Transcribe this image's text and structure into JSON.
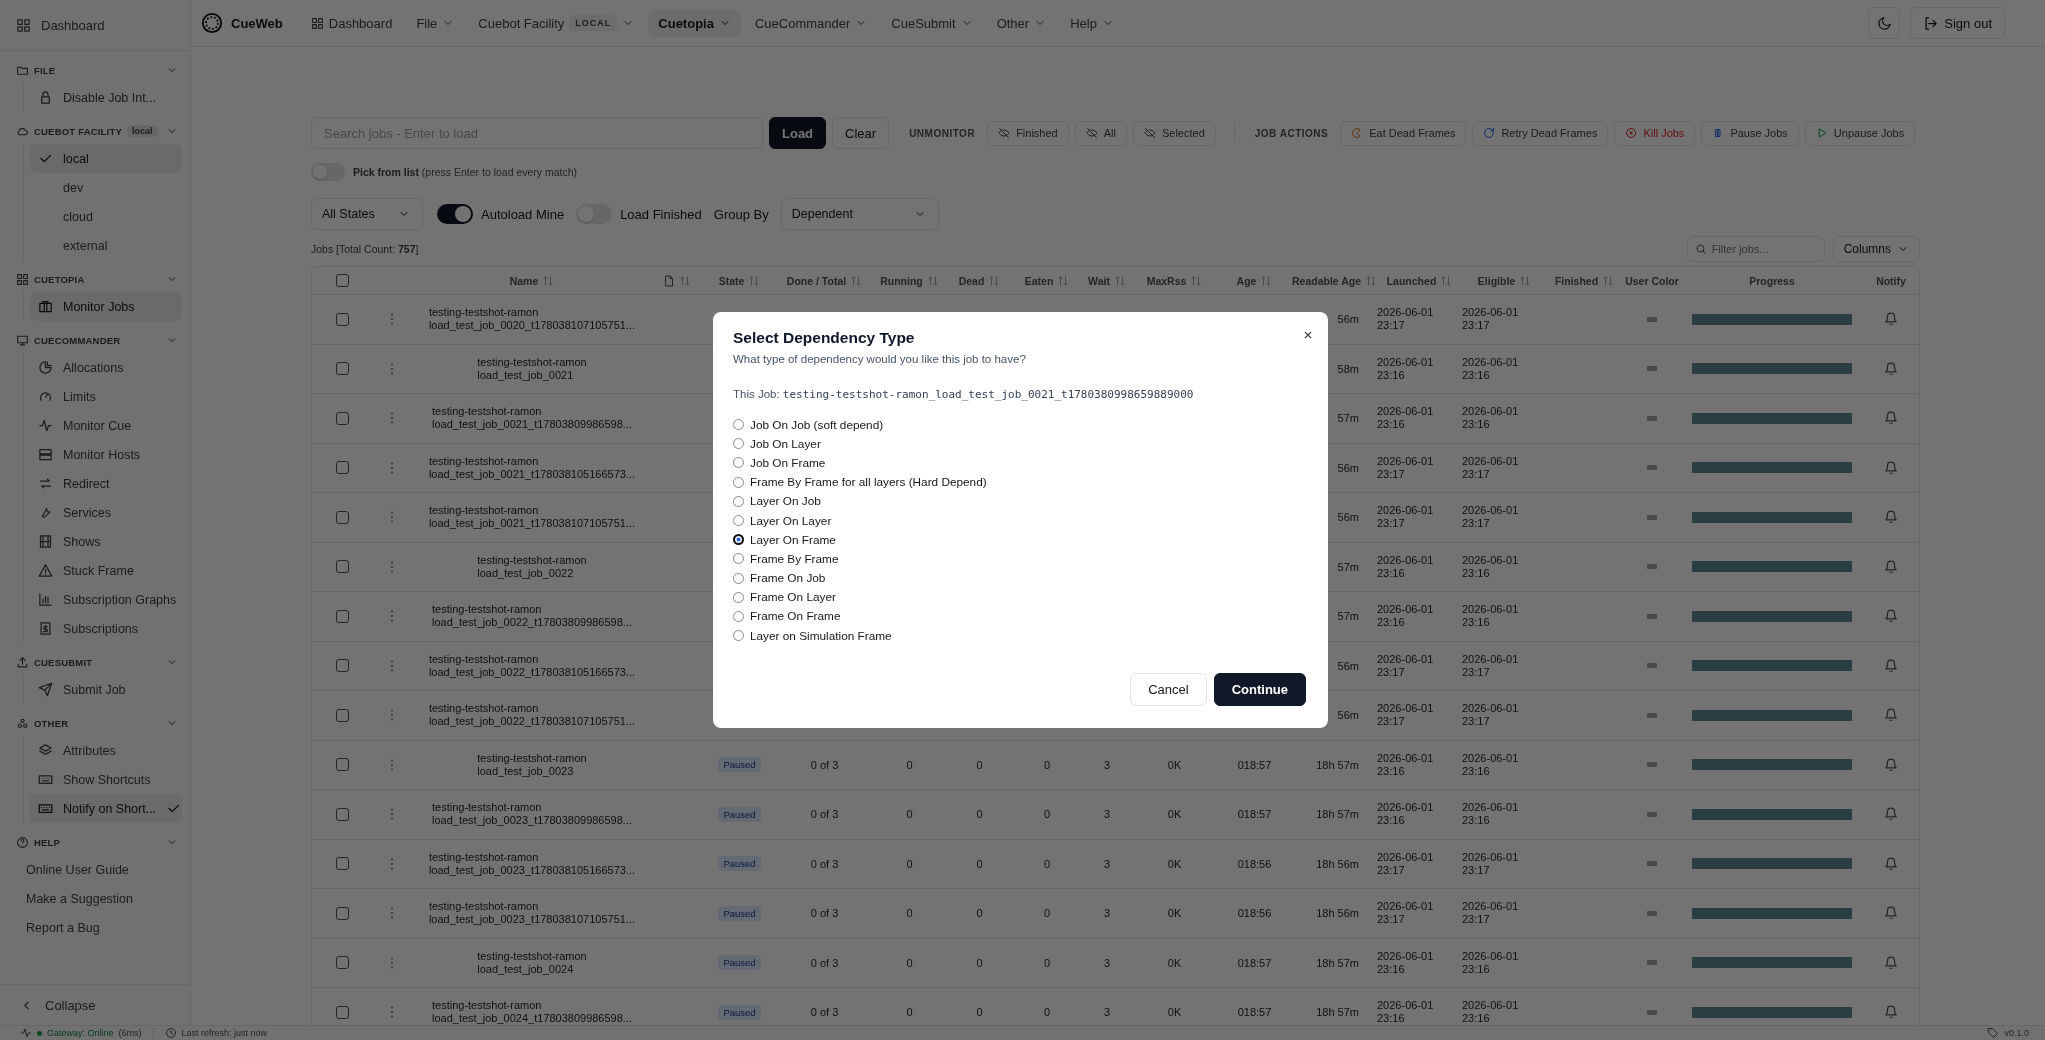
{
  "topbar": {
    "brand": "CueWeb",
    "nav": [
      {
        "label": "Dashboard",
        "kind": "link",
        "selected": false
      },
      {
        "label": "File",
        "kind": "menu",
        "selected": false
      },
      {
        "label": "Cuebot Facility",
        "kind": "menu",
        "badge": "LOCAL",
        "selected": false
      },
      {
        "label": "Cuetopia",
        "kind": "menu",
        "selected": true
      },
      {
        "label": "CueCommander",
        "kind": "menu",
        "selected": false
      },
      {
        "label": "CueSubmit",
        "kind": "menu",
        "selected": false
      },
      {
        "label": "Other",
        "kind": "menu",
        "selected": false
      },
      {
        "label": "Help",
        "kind": "menu",
        "selected": false
      }
    ],
    "sign_out": "Sign out"
  },
  "sidebar": {
    "dashboard": "Dashboard",
    "sections": [
      {
        "title": "FILE",
        "kind": "icons",
        "expanded": true,
        "items": [
          {
            "label": "Disable Job Int...",
            "selected": false,
            "checked": false
          }
        ]
      },
      {
        "title": "CUEBOT FACILITY",
        "badge": "local",
        "kind": "checks",
        "expanded": true,
        "items": [
          {
            "label": "local",
            "selected": true,
            "checked": true
          },
          {
            "label": "dev",
            "selected": false,
            "checked": false
          },
          {
            "label": "cloud",
            "selected": false,
            "checked": false
          },
          {
            "label": "external",
            "selected": false,
            "checked": false
          }
        ]
      },
      {
        "title": "CUETOPIA",
        "kind": "icons",
        "expanded": true,
        "items": [
          {
            "label": "Monitor Jobs",
            "selected": true,
            "checked": false
          }
        ]
      },
      {
        "title": "CUECOMMANDER",
        "kind": "icons",
        "expanded": true,
        "items": [
          {
            "label": "Allocations",
            "selected": false,
            "checked": false
          },
          {
            "label": "Limits",
            "selected": false,
            "checked": false
          },
          {
            "label": "Monitor Cue",
            "selected": false,
            "checked": false
          },
          {
            "label": "Monitor Hosts",
            "selected": false,
            "checked": false
          },
          {
            "label": "Redirect",
            "selected": false,
            "checked": false
          },
          {
            "label": "Services",
            "selected": false,
            "checked": false
          },
          {
            "label": "Shows",
            "selected": false,
            "checked": false
          },
          {
            "label": "Stuck Frame",
            "selected": false,
            "checked": false
          },
          {
            "label": "Subscription Graphs",
            "selected": false,
            "checked": false
          },
          {
            "label": "Subscriptions",
            "selected": false,
            "checked": false
          }
        ]
      },
      {
        "title": "CUESUBMIT",
        "kind": "icons",
        "expanded": true,
        "items": [
          {
            "label": "Submit Job",
            "selected": false,
            "checked": false
          }
        ]
      },
      {
        "title": "OTHER",
        "kind": "icons",
        "expanded": true,
        "items": [
          {
            "label": "Attributes",
            "selected": false,
            "checked": false
          },
          {
            "label": "Show Shortcuts",
            "selected": false,
            "checked": false
          },
          {
            "label": "Notify on Short...",
            "selected": true,
            "checked": true
          }
        ]
      },
      {
        "title": "HELP",
        "kind": "plain",
        "expanded": true,
        "items": [
          {
            "label": "Online User Guide",
            "selected": false,
            "checked": false
          },
          {
            "label": "Make a Suggestion",
            "selected": false,
            "checked": false
          },
          {
            "label": "Report a Bug",
            "selected": false,
            "checked": false
          }
        ]
      }
    ],
    "collapse": "Collapse"
  },
  "toolbar": {
    "search": {
      "placeholder": "Search jobs - Enter to load"
    },
    "load": "Load",
    "clear": "Clear",
    "unmonitor_label": "UNMONITOR",
    "unmonitor": [
      "Finished",
      "All",
      "Selected"
    ],
    "actions_label": "JOB ACTIONS",
    "actions": [
      {
        "label": "Eat Dead Frames",
        "kind": "normal"
      },
      {
        "label": "Retry Dead Frames",
        "kind": "normal"
      },
      {
        "label": "Kill Jobs",
        "kind": "danger"
      },
      {
        "label": "Pause Jobs",
        "kind": "normal"
      },
      {
        "label": "Unpause Jobs",
        "kind": "normal"
      }
    ]
  },
  "pick": {
    "on": false,
    "label": "Pick from list",
    "hint": "(press Enter to load every match)"
  },
  "filters": {
    "state": "All States",
    "autoload": {
      "label": "Autoload Mine",
      "on": true
    },
    "load_finished": {
      "label": "Load Finished",
      "on": false
    },
    "group_by_label": "Group By",
    "group_by": "Dependent"
  },
  "jobs_count": "Jobs [Total Count: **757**]",
  "filter_jobs": {
    "placeholder": "Filter jobs..."
  },
  "columns_button": "Columns",
  "table": {
    "all_checked": false,
    "columns": [
      {
        "kind": "text",
        "label": "Name",
        "sortable": true
      },
      {
        "kind": "file",
        "sortable": true
      },
      {
        "kind": "text",
        "label": "State",
        "sortable": true
      },
      {
        "kind": "text",
        "label": "Done / Total",
        "sortable": true
      },
      {
        "kind": "text",
        "label": "Running",
        "sortable": true
      },
      {
        "kind": "text",
        "label": "Dead",
        "sortable": true
      },
      {
        "kind": "text",
        "label": "Eaten",
        "sortable": true
      },
      {
        "kind": "text",
        "label": "Wait",
        "sortable": true
      },
      {
        "kind": "text",
        "label": "MaxRss",
        "sortable": true
      },
      {
        "kind": "text",
        "label": "Age",
        "sortable": true
      },
      {
        "kind": "text",
        "label": "Readable Age",
        "sortable": true
      },
      {
        "kind": "text",
        "label": "Launched",
        "sortable": true
      },
      {
        "kind": "text",
        "label": "Eligible",
        "sortable": true
      },
      {
        "kind": "text",
        "label": "Finished",
        "sortable": true
      },
      {
        "kind": "text",
        "label": "User Color",
        "sortable": false
      },
      {
        "kind": "text",
        "label": "Progress",
        "sortable": false
      },
      {
        "kind": "text",
        "label": "Notify",
        "sortable": false
      }
    ],
    "rows": [
      {
        "checked": false,
        "show": "testing-testshot-ramon",
        "job": "load_test_job_0020_t178038107105751...",
        "readable_age": "56m",
        "launched": [
          "2026-06-01",
          "23:17"
        ],
        "eligible": [
          "2026-06-01",
          "23:17"
        ],
        "level": 0
      },
      {
        "checked": false,
        "show": "testing-testshot-ramon",
        "job": "load_test_job_0021",
        "readable_age": "58m",
        "launched": [
          "2026-06-01",
          "23:16"
        ],
        "eligible": [
          "2026-06-01",
          "23:16"
        ],
        "level": 0
      },
      {
        "checked": false,
        "show": "testing-testshot-ramon",
        "job": "load_test_job_0021_t17803809986598...",
        "readable_age": "57m",
        "launched": [
          "2026-06-01",
          "23:16"
        ],
        "eligible": [
          "2026-06-01",
          "23:16"
        ],
        "level": 0
      },
      {
        "checked": false,
        "show": "testing-testshot-ramon",
        "job": "load_test_job_0021_t178038105166573...",
        "readable_age": "56m",
        "launched": [
          "2026-06-01",
          "23:17"
        ],
        "eligible": [
          "2026-06-01",
          "23:17"
        ],
        "level": 0
      },
      {
        "checked": false,
        "show": "testing-testshot-ramon",
        "job": "load_test_job_0021_t178038107105751...",
        "readable_age": "56m",
        "launched": [
          "2026-06-01",
          "23:17"
        ],
        "eligible": [
          "2026-06-01",
          "23:17"
        ],
        "level": 0
      },
      {
        "checked": false,
        "show": "testing-testshot-ramon",
        "job": "load_test_job_0022",
        "readable_age": "57m",
        "launched": [
          "2026-06-01",
          "23:16"
        ],
        "eligible": [
          "2026-06-01",
          "23:16"
        ],
        "level": 0
      },
      {
        "checked": false,
        "show": "testing-testshot-ramon",
        "job": "load_test_job_0022_t17803809986598...",
        "readable_age": "57m",
        "launched": [
          "2026-06-01",
          "23:16"
        ],
        "eligible": [
          "2026-06-01",
          "23:16"
        ],
        "level": 0
      },
      {
        "checked": false,
        "show": "testing-testshot-ramon",
        "job": "load_test_job_0022_t178038105166573...",
        "readable_age": "56m",
        "launched": [
          "2026-06-01",
          "23:17"
        ],
        "eligible": [
          "2026-06-01",
          "23:17"
        ],
        "level": 0
      },
      {
        "checked": false,
        "show": "testing-testshot-ramon",
        "job": "load_test_job_0022_t178038107105751...",
        "readable_age": "56m",
        "launched": [
          "2026-06-01",
          "23:17"
        ],
        "eligible": [
          "2026-06-01",
          "23:17"
        ],
        "level": 0
      },
      {
        "checked": false,
        "show": "testing-testshot-ramon",
        "job": "load_test_job_0023",
        "state": "Paused",
        "done_total": "0 of 3",
        "running": "0",
        "dead": "0",
        "eaten": "0",
        "wait": "3",
        "maxrss": "0K",
        "age": "018:57",
        "readable_age": "18h 57m",
        "launched": [
          "2026-06-01",
          "23:16"
        ],
        "eligible": [
          "2026-06-01",
          "23:16"
        ],
        "level": 0
      },
      {
        "checked": false,
        "show": "testing-testshot-ramon",
        "job": "load_test_job_0023_t17803809986598...",
        "state": "Paused",
        "done_total": "0 of 3",
        "running": "0",
        "dead": "0",
        "eaten": "0",
        "wait": "3",
        "maxrss": "0K",
        "age": "018:57",
        "readable_age": "18h 57m",
        "launched": [
          "2026-06-01",
          "23:16"
        ],
        "eligible": [
          "2026-06-01",
          "23:16"
        ],
        "level": 0
      },
      {
        "checked": false,
        "show": "testing-testshot-ramon",
        "job": "load_test_job_0023_t178038105166573...",
        "state": "Paused",
        "done_total": "0 of 3",
        "running": "0",
        "dead": "0",
        "eaten": "0",
        "wait": "3",
        "maxrss": "0K",
        "age": "018:56",
        "readable_age": "18h 56m",
        "launched": [
          "2026-06-01",
          "23:17"
        ],
        "eligible": [
          "2026-06-01",
          "23:17"
        ],
        "level": 0
      },
      {
        "checked": false,
        "show": "testing-testshot-ramon",
        "job": "load_test_job_0023_t178038107105751...",
        "state": "Paused",
        "done_total": "0 of 3",
        "running": "0",
        "dead": "0",
        "eaten": "0",
        "wait": "3",
        "maxrss": "0K",
        "age": "018:56",
        "readable_age": "18h 56m",
        "launched": [
          "2026-06-01",
          "23:17"
        ],
        "eligible": [
          "2026-06-01",
          "23:17"
        ],
        "level": 0
      },
      {
        "checked": false,
        "show": "testing-testshot-ramon",
        "job": "load_test_job_0024",
        "state": "Paused",
        "done_total": "0 of 3",
        "running": "0",
        "dead": "0",
        "eaten": "0",
        "wait": "3",
        "maxrss": "0K",
        "age": "018:57",
        "readable_age": "18h 57m",
        "launched": [
          "2026-06-01",
          "23:16"
        ],
        "eligible": [
          "2026-06-01",
          "23:16"
        ],
        "level": 0
      },
      {
        "checked": false,
        "show": "testing-testshot-ramon",
        "job": "load_test_job_0024_t17803809986598...",
        "state": "Paused",
        "done_total": "0 of 3",
        "running": "0",
        "dead": "0",
        "eaten": "0",
        "wait": "3",
        "maxrss": "0K",
        "age": "018:57",
        "readable_age": "18h 57m",
        "launched": [
          "2026-06-01",
          "23:16"
        ],
        "eligible": [
          "2026-06-01",
          "23:16"
        ],
        "level": 0
      }
    ]
  },
  "status_bar": {
    "gateway": "Gateway: Online",
    "latency": "(6ms)",
    "refresh": "Last refresh: just now",
    "version": "v0.1.0"
  },
  "dialog": {
    "title": "Select Dependency Type",
    "subtitle": "What type of dependency would you like this job to have?",
    "job_label": "This Job:",
    "job_name": "testing-testshot-ramon_load_test_job_0021_t1780380998659889000",
    "options": [
      {
        "label": "Job On Job (soft depend)",
        "selected": false
      },
      {
        "label": "Job On Layer",
        "selected": false
      },
      {
        "label": "Job On Frame",
        "selected": false
      },
      {
        "label": "Frame By Frame for all layers (Hard Depend)",
        "selected": false
      },
      {
        "label": "Layer On Job",
        "selected": false
      },
      {
        "label": "Layer On Layer",
        "selected": false
      },
      {
        "label": "Layer On Frame",
        "selected": true
      },
      {
        "label": "Frame By Frame",
        "selected": false
      },
      {
        "label": "Frame On Job",
        "selected": false
      },
      {
        "label": "Frame On Layer",
        "selected": false
      },
      {
        "label": "Frame On Frame",
        "selected": false
      },
      {
        "label": "Layer on Simulation Frame",
        "selected": false
      }
    ],
    "cancel": "Cancel",
    "continue": "Continue"
  }
}
